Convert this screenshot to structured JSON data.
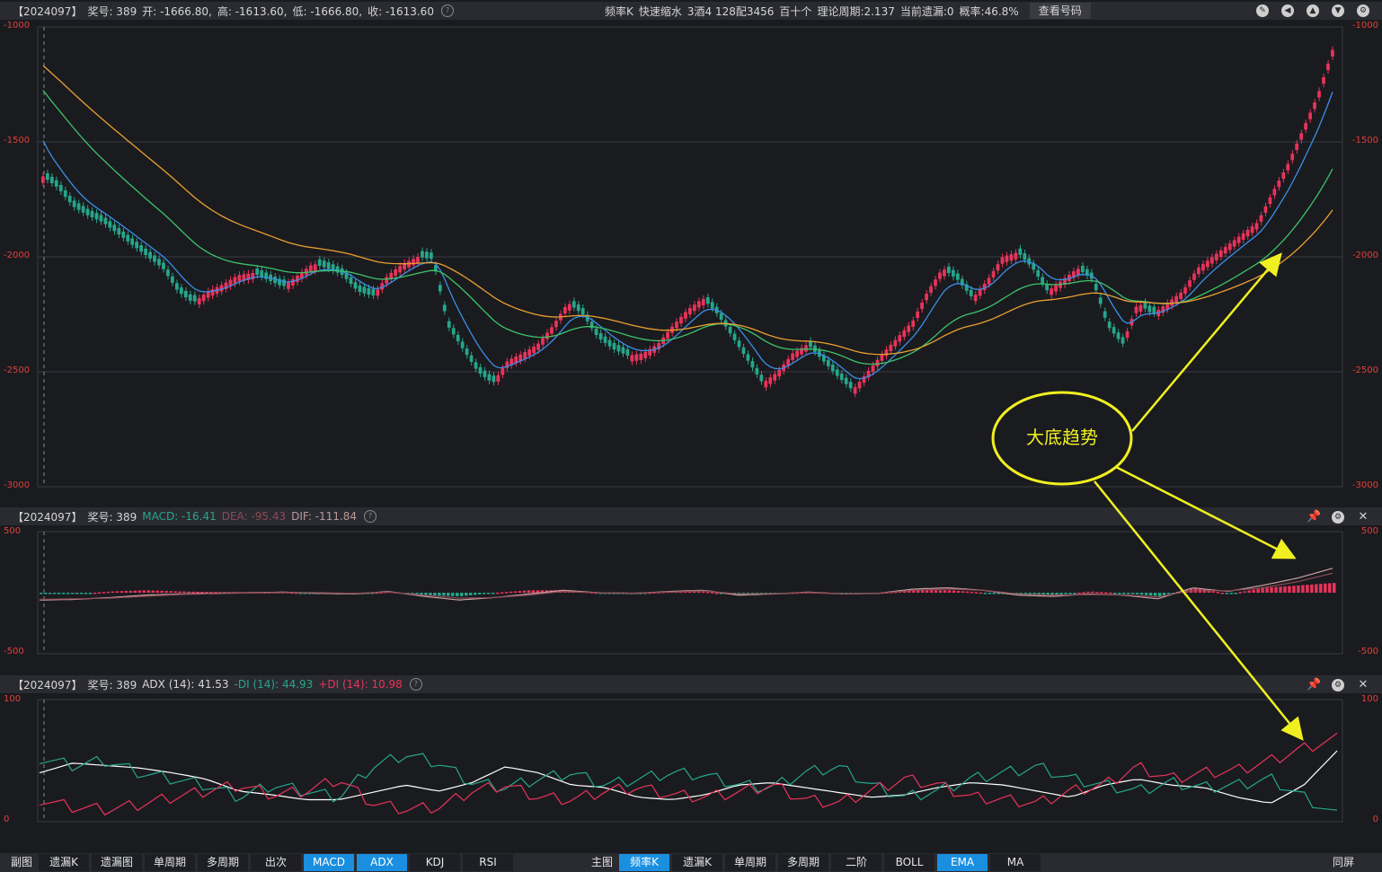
{
  "main_header": {
    "issue": "【2024097】",
    "prize_label": "奖号: 389",
    "open": "开: -1666.80,",
    "high": "高: -1613.60,",
    "low": "低: -1666.80,",
    "close": "收: -1613.60",
    "info_icon": "question-icon",
    "mode": "频率K",
    "shrink": "快速缩水",
    "combo": "3酒4 128配3456",
    "range": "百十个",
    "period": "理论周期:2.137",
    "current_miss": "当前遗漏:0",
    "probability": "概率:46.8%",
    "look_button": "查看号码"
  },
  "main_axis": {
    "labels": [
      "-1000",
      "-1500",
      "-2000",
      "-2500",
      "-3000"
    ]
  },
  "macd_header": {
    "issue": "【2024097】",
    "prize_label": "奖号: 389",
    "macd": "MACD: -16.41",
    "dea": "DEA: -95.43",
    "dif": "DIF: -111.84"
  },
  "macd_axis": {
    "labels": [
      "500",
      "-500"
    ]
  },
  "adx_header": {
    "issue": "【2024097】",
    "prize_label": "奖号: 389",
    "adx": "ADX (14): 41.53",
    "mdi": "-DI (14): 44.93",
    "pdi": "+DI (14): 10.98"
  },
  "adx_axis": {
    "labels": [
      "100",
      "0"
    ]
  },
  "annotation": {
    "text": "大底趋势"
  },
  "colors": {
    "up": "#e8335a",
    "down": "#26a68a",
    "ema_fast": "#3a8ee8",
    "ema_mid": "#3cc46a",
    "ema_slow": "#e8a030",
    "axis_text": "#e0403a",
    "active_button": "#1a8fe0",
    "annotation": "#f0f020"
  },
  "toolbar": {
    "left_label": "副图",
    "left_items": [
      "遗漏K",
      "遗漏图",
      "单周期",
      "多周期",
      "出次",
      "MACD",
      "ADX",
      "KDJ",
      "RSI"
    ],
    "left_active": [
      "MACD",
      "ADX"
    ],
    "right_label": "主图",
    "right_items": [
      "频率K",
      "遗漏K",
      "单周期",
      "多周期",
      "二阶",
      "BOLL",
      "EMA",
      "MA"
    ],
    "right_active": [
      "频率K",
      "EMA"
    ],
    "end_item": "同屏"
  },
  "chart_data": [
    {
      "type": "candlestick",
      "ylim": [
        -3000,
        -1000
      ],
      "close_series_approx": [
        -1650,
        -1700,
        -1780,
        -1820,
        -1850,
        -1900,
        -1950,
        -2000,
        -2050,
        -2150,
        -2200,
        -2150,
        -2120,
        -2080,
        -2070,
        -2100,
        -2130,
        -2080,
        -2030,
        -2050,
        -2080,
        -2150,
        -2170,
        -2080,
        -2030,
        -2000,
        -2010,
        -2300,
        -2400,
        -2500,
        -2550,
        -2450,
        -2420,
        -2380,
        -2300,
        -2200,
        -2250,
        -2350,
        -2400,
        -2430,
        -2420,
        -2380,
        -2300,
        -2230,
        -2180,
        -2250,
        -2350,
        -2450,
        -2550,
        -2500,
        -2420,
        -2380,
        -2450,
        -2520,
        -2580,
        -2500,
        -2420,
        -2350,
        -2280,
        -2150,
        -2050,
        -2100,
        -2180,
        -2100,
        -2000,
        -1980,
        -2050,
        -2150,
        -2100,
        -2050,
        -2100,
        -2300,
        -2380,
        -2200,
        -2250,
        -2200,
        -2150,
        -2050,
        -2000,
        -1950,
        -1900,
        -1850,
        -1720,
        -1600,
        -1450,
        -1300,
        -1100
      ],
      "ema_series": [
        {
          "name": "EMA short",
          "start": -1450,
          "end": -1380
        },
        {
          "name": "EMA mid",
          "start": -1250,
          "end": -1720
        },
        {
          "name": "EMA long",
          "start": -1150,
          "end": -1840
        }
      ]
    },
    {
      "type": "line",
      "ylim": [
        -500,
        500
      ],
      "series": [
        {
          "name": "DIF",
          "values": [
            -60,
            -55,
            -40,
            -20,
            -10,
            -5,
            0,
            5,
            -5,
            -10,
            10,
            -30,
            -60,
            -40,
            -10,
            20,
            0,
            -5,
            10,
            20,
            -20,
            -10,
            5,
            -10,
            -5,
            30,
            40,
            20,
            -20,
            -30,
            -10,
            -20,
            -50,
            40,
            10,
            60,
            120,
            200
          ]
        },
        {
          "name": "DEA",
          "values": [
            -55,
            -50,
            -45,
            -30,
            -15,
            -8,
            -2,
            2,
            0,
            -5,
            5,
            -20,
            -45,
            -40,
            -20,
            10,
            0,
            -3,
            5,
            15,
            -10,
            -8,
            2,
            -8,
            -5,
            20,
            30,
            20,
            -10,
            -20,
            -15,
            -18,
            -35,
            20,
            15,
            40,
            90,
            160
          ]
        }
      ]
    },
    {
      "type": "line",
      "ylim": [
        0,
        100
      ],
      "series": [
        {
          "name": "ADX",
          "values": [
            40,
            48,
            46,
            44,
            40,
            35,
            25,
            22,
            18,
            18,
            24,
            30,
            25,
            32,
            45,
            40,
            30,
            28,
            20,
            18,
            22,
            30,
            32,
            28,
            24,
            20,
            22,
            28,
            32,
            30,
            25,
            20,
            30,
            35,
            30,
            28,
            20,
            15,
            30,
            58
          ]
        },
        {
          "name": "-DI",
          "values": [
            52,
            46,
            50,
            40,
            35,
            30,
            20,
            30,
            25,
            20,
            45,
            55,
            48,
            32,
            28,
            35,
            40,
            30,
            35,
            40,
            38,
            30,
            28,
            40,
            45,
            30,
            20,
            25,
            35,
            40,
            45,
            35,
            30,
            25,
            32,
            28,
            30,
            35,
            20,
            5
          ]
        },
        {
          "name": "+DI",
          "values": [
            18,
            12,
            10,
            14,
            20,
            25,
            30,
            22,
            25,
            35,
            15,
            10,
            12,
            25,
            30,
            20,
            18,
            25,
            28,
            22,
            20,
            24,
            30,
            18,
            15,
            25,
            35,
            30,
            20,
            18,
            15,
            25,
            30,
            45,
            35,
            40,
            42,
            50,
            60,
            68
          ]
        }
      ]
    }
  ]
}
